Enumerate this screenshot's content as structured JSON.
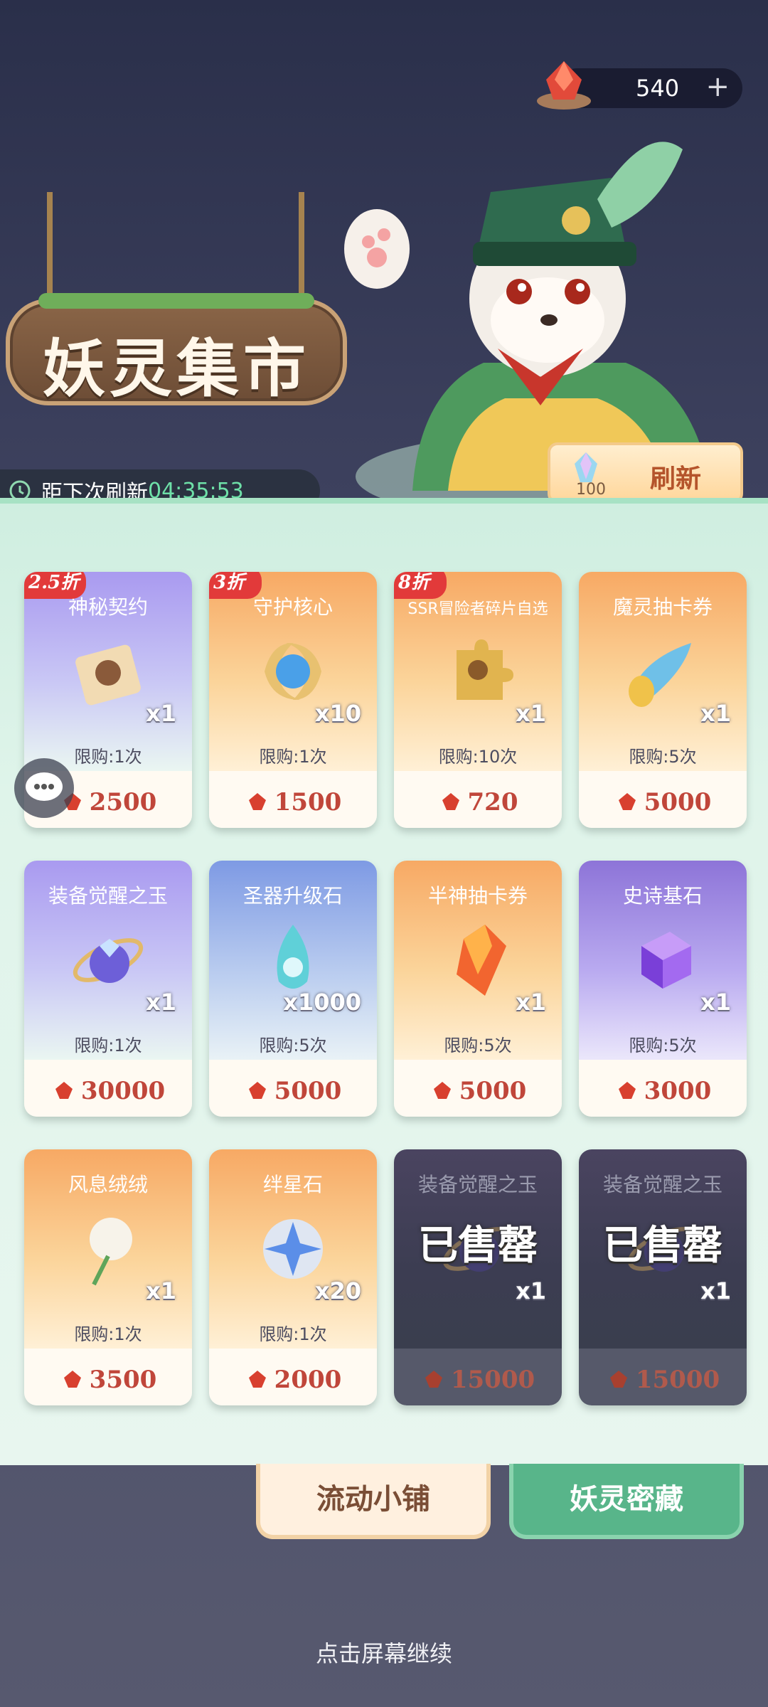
{
  "currency": {
    "amount": "540",
    "plus": "+"
  },
  "sign": {
    "title": "妖灵集市"
  },
  "timer": {
    "label": "距下次刷新",
    "time": "04:35:53"
  },
  "refresh": {
    "cost": "100",
    "label": "刷新"
  },
  "items": [
    {
      "name": "神秘契约",
      "qty": "x1",
      "limit": "限购:1次",
      "price": "2500",
      "badge": "2.5折",
      "theme": "purple"
    },
    {
      "name": "守护核心",
      "qty": "x10",
      "limit": "限购:1次",
      "price": "1500",
      "badge": "3折",
      "theme": "orange"
    },
    {
      "name": "SSR冒险者碎片自选",
      "qty": "x1",
      "limit": "限购:10次",
      "price": "720",
      "badge": "8折",
      "theme": "orange"
    },
    {
      "name": "魔灵抽卡券",
      "qty": "x1",
      "limit": "限购:5次",
      "price": "5000",
      "theme": "orange"
    },
    {
      "name": "装备觉醒之玉",
      "qty": "x1",
      "limit": "限购:1次",
      "price": "30000",
      "theme": "purple"
    },
    {
      "name": "圣器升级石",
      "qty": "x1000",
      "limit": "限购:5次",
      "price": "5000",
      "theme": "blue"
    },
    {
      "name": "半神抽卡券",
      "qty": "x1",
      "limit": "限购:5次",
      "price": "5000",
      "theme": "orange"
    },
    {
      "name": "史诗基石",
      "qty": "x1",
      "limit": "限购:5次",
      "price": "3000",
      "theme": "violet"
    },
    {
      "name": "风息绒绒",
      "qty": "x1",
      "limit": "限购:1次",
      "price": "3500",
      "theme": "orange"
    },
    {
      "name": "绊星石",
      "qty": "x20",
      "limit": "限购:1次",
      "price": "2000",
      "theme": "orange"
    },
    {
      "name": "装备觉醒之玉",
      "qty": "x1",
      "price": "15000",
      "sold": "已售罄",
      "theme": "sold"
    },
    {
      "name": "装备觉醒之玉",
      "qty": "x1",
      "price": "15000",
      "sold": "已售罄",
      "theme": "sold"
    }
  ],
  "tabs": {
    "left": "流动小铺",
    "right": "妖灵密藏"
  },
  "hint": "点击屏幕继续",
  "colors": {
    "accent_price": "#c0463a",
    "timer_green": "#6ee0a8",
    "discount_red": "#e23a3a"
  }
}
